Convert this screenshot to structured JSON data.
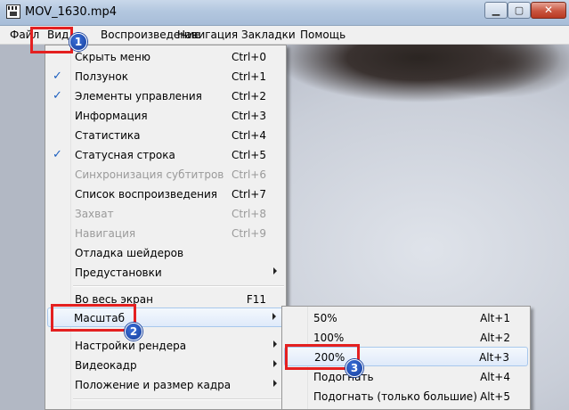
{
  "window": {
    "title": "MOV_1630.mp4",
    "min_glyph": "▁",
    "max_glyph": "▢",
    "close_glyph": "✕"
  },
  "menubar": {
    "items": [
      {
        "label": "Файл"
      },
      {
        "label": "Вид"
      },
      {
        "label": "Воспроизведение"
      },
      {
        "label": "Навигация"
      },
      {
        "label": "Закладки"
      },
      {
        "label": "Помощь"
      }
    ]
  },
  "view_menu": {
    "items": [
      {
        "label": "Скрыть меню",
        "shortcut": "Ctrl+0",
        "checked": false,
        "disabled": false,
        "submenu": false
      },
      {
        "label": "Ползунок",
        "shortcut": "Ctrl+1",
        "checked": true,
        "disabled": false,
        "submenu": false
      },
      {
        "label": "Элементы управления",
        "shortcut": "Ctrl+2",
        "checked": true,
        "disabled": false,
        "submenu": false
      },
      {
        "label": "Информация",
        "shortcut": "Ctrl+3",
        "checked": false,
        "disabled": false,
        "submenu": false
      },
      {
        "label": "Статистика",
        "shortcut": "Ctrl+4",
        "checked": false,
        "disabled": false,
        "submenu": false
      },
      {
        "label": "Статусная строка",
        "shortcut": "Ctrl+5",
        "checked": true,
        "disabled": false,
        "submenu": false
      },
      {
        "label": "Синхронизация субтитров",
        "shortcut": "Ctrl+6",
        "checked": false,
        "disabled": true,
        "submenu": false
      },
      {
        "label": "Список воспроизведения",
        "shortcut": "Ctrl+7",
        "checked": false,
        "disabled": false,
        "submenu": false
      },
      {
        "label": "Захват",
        "shortcut": "Ctrl+8",
        "checked": false,
        "disabled": true,
        "submenu": false
      },
      {
        "label": "Навигация",
        "shortcut": "Ctrl+9",
        "checked": false,
        "disabled": true,
        "submenu": false
      },
      {
        "label": "Отладка шейдеров",
        "shortcut": "",
        "checked": false,
        "disabled": false,
        "submenu": false
      },
      {
        "label": "Предустановки",
        "shortcut": "",
        "checked": false,
        "disabled": false,
        "submenu": true
      },
      {
        "label": "Во весь экран",
        "shortcut": "F11",
        "checked": false,
        "disabled": false,
        "submenu": false
      },
      {
        "label": "Масштаб",
        "shortcut": "",
        "checked": false,
        "disabled": false,
        "submenu": true
      },
      {
        "label": "Настройки рендера",
        "shortcut": "",
        "checked": false,
        "disabled": false,
        "submenu": true
      },
      {
        "label": "Видеокадр",
        "shortcut": "",
        "checked": false,
        "disabled": false,
        "submenu": true
      },
      {
        "label": "Положение и размер кадра",
        "shortcut": "",
        "checked": false,
        "disabled": false,
        "submenu": true
      }
    ]
  },
  "zoom_submenu": {
    "items": [
      {
        "label": "50%",
        "shortcut": "Alt+1"
      },
      {
        "label": "100%",
        "shortcut": "Alt+2"
      },
      {
        "label": "200%",
        "shortcut": "Alt+3"
      },
      {
        "label": "Подогнать",
        "shortcut": "Alt+4"
      },
      {
        "label": "Подогнать (только большие)",
        "shortcut": "Alt+5"
      }
    ]
  },
  "annotations": {
    "badge1": "1",
    "badge2": "2",
    "badge3": "3"
  },
  "colors": {
    "annotation_red": "#e42020",
    "badge_blue": "#1e4fb8",
    "check_blue": "#1c5fbf"
  }
}
